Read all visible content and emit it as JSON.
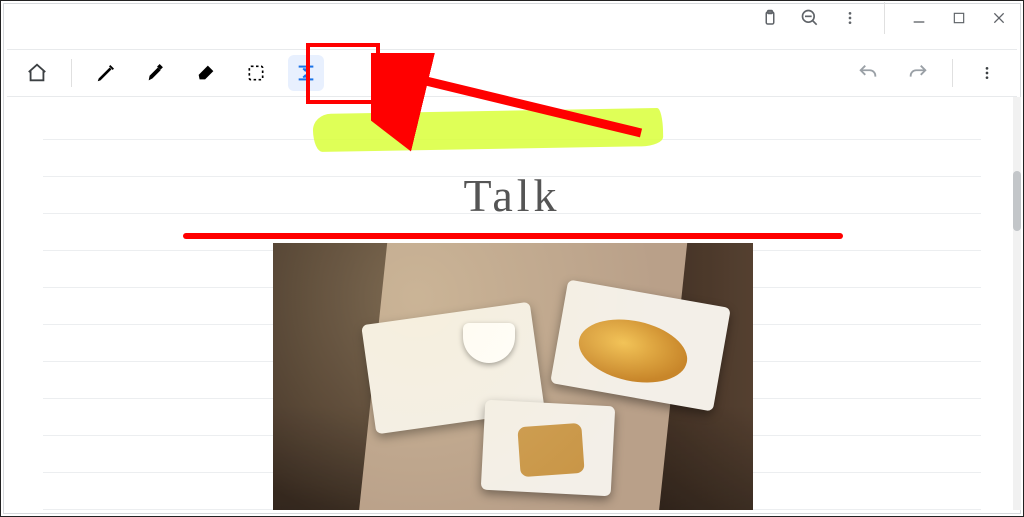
{
  "window_controls": {
    "clipboard": "clipboard-icon",
    "zoom_out": "zoom-out-icon",
    "more": "more-icon",
    "minimize": "minimize-icon",
    "maximize": "maximize-icon",
    "close": "close-icon"
  },
  "toolbar": {
    "home": "home-icon",
    "pen": "pen-icon",
    "highlighter": "highlighter-icon",
    "eraser": "eraser-icon",
    "select": "select-icon",
    "compact": "compact-icon",
    "undo": "undo-icon",
    "redo": "redo-icon",
    "overflow": "vertical-more-icon"
  },
  "page": {
    "handwritten_text": "Talk"
  },
  "annotations": {
    "highlight_target": "compact-tool",
    "arrow_color": "#ff0000",
    "line_color": "#ff0000",
    "highlighter_color": "#d9ff3a"
  }
}
